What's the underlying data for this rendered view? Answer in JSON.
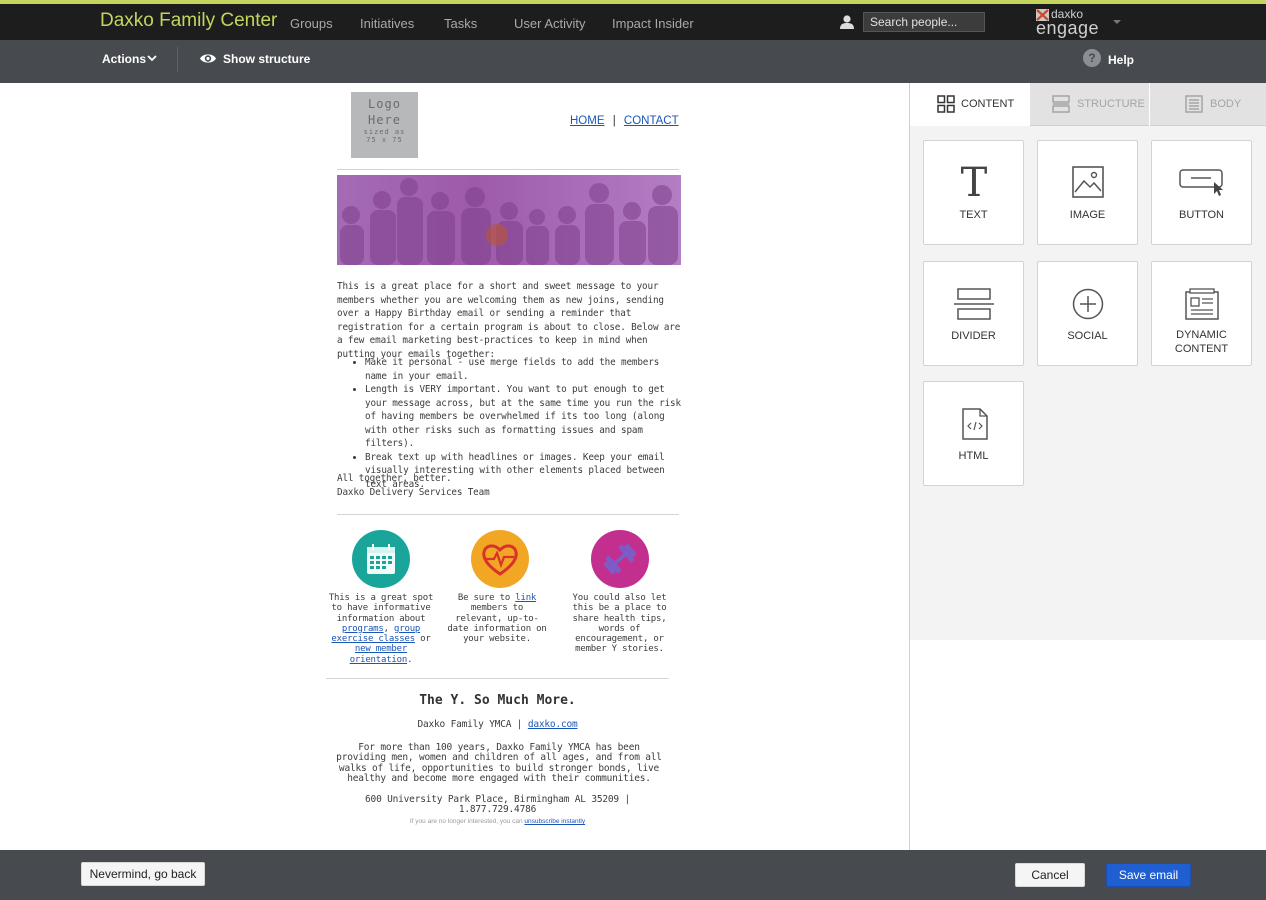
{
  "topnav": {
    "brand": "Daxko Family Center",
    "links": [
      "Groups",
      "Initiatives",
      "Tasks",
      "User Activity",
      "Impact Insider"
    ],
    "search_placeholder": "Search people...",
    "logo_line1": "daxko",
    "logo_line2": "engage"
  },
  "toolbar": {
    "actions_label": "Actions",
    "show_structure_label": "Show structure",
    "help_label": "Help",
    "help_glyph": "?"
  },
  "email": {
    "logo": {
      "line1": "Logo",
      "line2": "Here",
      "line3": "sized as",
      "line4": "75 x 75"
    },
    "header_links": {
      "home": "HOME",
      "separator": "|",
      "contact": "CONTACT"
    },
    "intro": "This is a great place for a short and sweet message to your members whether you are welcoming them as new joins, sending over a Happy Birthday email or sending a reminder that registration for a certain program is about to close. Below are a few email marketing best-practices to keep in mind when putting your emails together:",
    "bullets": [
      "Make it personal - use merge fields to add the members name in your email.",
      "Length is VERY important. You want to put enough to get your message across, but at the same time you run the risk of having members be overwhelmed if its too long (along with other risks such as formatting issues and spam filters).",
      "Break text up with headlines or images. Keep your email visually interesting with other elements placed between text areas."
    ],
    "signoff_line1": "All together, better.",
    "signoff_line2": "Daxko Delivery Services Team",
    "col1": {
      "t1": "This is a great spot to have informative information about ",
      "link1": "programs",
      "t2": ", ",
      "link2": "group exercise classes",
      "t3": " or ",
      "link3": "new member orientation",
      "t4": "."
    },
    "col2": {
      "t1": "Be sure to ",
      "link1": "link",
      "t2": " members to relevant, up-to-date information on your website."
    },
    "col3": {
      "t1": "You could also let this be a place to share health tips, words of encouragement, or member Y stories."
    },
    "footer": {
      "headline": "The Y. So Much More.",
      "org": "Daxko Family YMCA | ",
      "org_link": "daxko.com",
      "about": "For more than 100 years, Daxko Family YMCA has been providing men, women and children of all ages, and from all walks of life, opportunities to build stronger bonds, live healthy and become more engaged with their communities.",
      "address": "600 University Park Place, Birmingham AL 35209 | 1.877.729.4786",
      "unsub_text": "If you are no longer interested, you can ",
      "unsub_link": "unsubscribe instantly"
    },
    "colors": {
      "teal": "#1aa59a",
      "orange": "#f2a724",
      "magenta": "#c32f8e",
      "hero_purple": "#9d5aa9"
    }
  },
  "panel": {
    "tabs": [
      "CONTENT",
      "STRUCTURE",
      "BODY"
    ],
    "active_tab": "CONTENT",
    "tiles": [
      {
        "label": "TEXT",
        "icon": "text-icon"
      },
      {
        "label": "IMAGE",
        "icon": "image-icon"
      },
      {
        "label": "BUTTON",
        "icon": "button-icon"
      },
      {
        "label": "DIVIDER",
        "icon": "divider-icon"
      },
      {
        "label": "SOCIAL",
        "icon": "social-icon"
      },
      {
        "label": "DYNAMIC",
        "label2": "CONTENT",
        "icon": "dynamic-content-icon"
      },
      {
        "label": "HTML",
        "icon": "html-icon"
      }
    ]
  },
  "bottombar": {
    "nevermind": "Nevermind, go back",
    "cancel": "Cancel",
    "save": "Save email"
  }
}
